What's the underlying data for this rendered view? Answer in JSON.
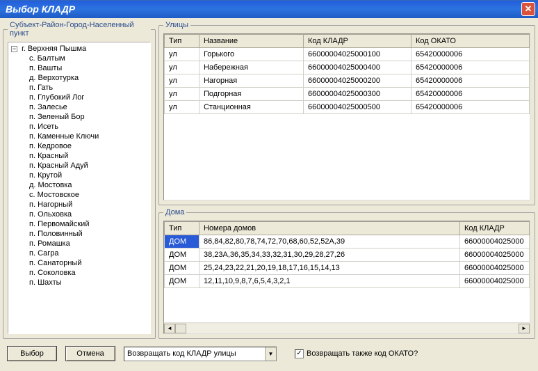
{
  "window": {
    "title": "Выбор КЛАДР"
  },
  "tree": {
    "groupLabel": "Субъект-Район-Город-Населенный пункт",
    "root": "г. Верхняя Пышма",
    "children": [
      "с. Балтым",
      "п. Вашты",
      "д. Верхотурка",
      "п. Гать",
      "п. Глубокий Лог",
      "п. Залесье",
      "п. Зеленый Бор",
      "п. Исеть",
      "п. Каменные Ключи",
      "п. Кедровое",
      "п. Красный",
      "п. Красный Адуй",
      "п. Крутой",
      "д. Мостовка",
      "с. Мостовское",
      "п. Нагорный",
      "п. Ольховка",
      "п. Первомайский",
      "п. Половинный",
      "п. Ромашка",
      "п. Сагра",
      "п. Санаторный",
      "п. Соколовка",
      "п. Шахты"
    ]
  },
  "streets": {
    "groupLabel": "Улицы",
    "columns": [
      "Тип",
      "Название",
      "Код КЛАДР",
      "Код ОКАТО"
    ],
    "rows": [
      {
        "c0": "ул",
        "c1": "Горького",
        "c2": "66000004025000100",
        "c3": "65420000006"
      },
      {
        "c0": "ул",
        "c1": "Набережная",
        "c2": "66000004025000400",
        "c3": "65420000006"
      },
      {
        "c0": "ул",
        "c1": "Нагорная",
        "c2": "66000004025000200",
        "c3": "65420000006"
      },
      {
        "c0": "ул",
        "c1": "Подгорная",
        "c2": "66000004025000300",
        "c3": "65420000006"
      },
      {
        "c0": "ул",
        "c1": "Станционная",
        "c2": "66000004025000500",
        "c3": "65420000006"
      }
    ]
  },
  "houses": {
    "groupLabel": "Дома",
    "columns": [
      "Тип",
      "Номера домов",
      "Код КЛАДР"
    ],
    "rows": [
      {
        "c0": "ДОМ",
        "c1": "86,84,82,80,78,74,72,70,68,60,52,52А,39",
        "c2": "66000004025000"
      },
      {
        "c0": "ДОМ",
        "c1": "38,23А,36,35,34,33,32,31,30,29,28,27,26",
        "c2": "66000004025000"
      },
      {
        "c0": "ДОМ",
        "c1": "25,24,23,22,21,20,19,18,17,16,15,14,13",
        "c2": "66000004025000"
      },
      {
        "c0": "ДОМ",
        "c1": "12,11,10,9,8,7,6,5,4,3,2,1",
        "c2": "66000004025000"
      }
    ]
  },
  "bottom": {
    "selectBtn": "Выбор",
    "cancelBtn": "Отмена",
    "comboValue": "Возвращать код КЛАДР улицы",
    "checkboxLabel": "Возвращать также код ОКАТО?"
  }
}
